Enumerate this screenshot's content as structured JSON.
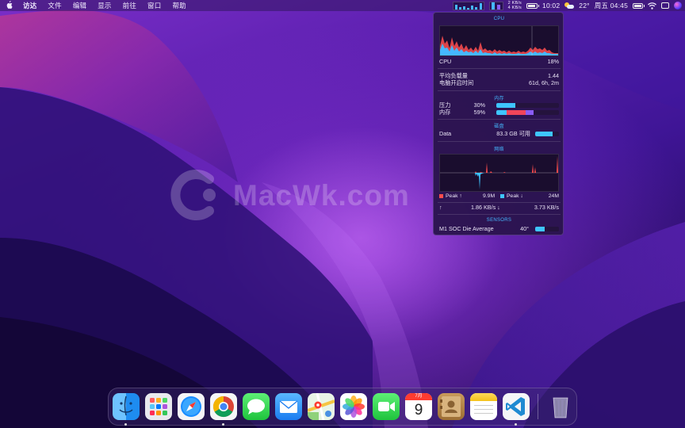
{
  "menubar": {
    "items": [
      "访达",
      "文件",
      "编辑",
      "显示",
      "前往",
      "窗口",
      "帮助"
    ],
    "status": {
      "net_up": "2 KB/s",
      "net_down": "4 KB/s",
      "time_short": "10:02",
      "temperature": "22°",
      "datetime": "周五 04:45"
    },
    "icons": [
      "apple-icon",
      "stats-graph-icon",
      "battery-icon",
      "weather-icon",
      "wifi-icon",
      "control-center-icon",
      "siri-icon"
    ]
  },
  "popup": {
    "cpu": {
      "title": "CPU",
      "label": "CPU",
      "usage": "18%",
      "load_label": "平均负载量",
      "load_value": "1.44",
      "uptime_label": "电脑开启时间",
      "uptime_value": "61d, 6h, 2m"
    },
    "memory": {
      "title": "内存",
      "pressure_label": "压力",
      "pressure_value": "30%",
      "pressure_fraction": 0.3,
      "mem_label": "内存",
      "mem_value": "59%",
      "mem_fraction": 0.59
    },
    "disk": {
      "title": "磁盘",
      "name": "Data",
      "free": "83.3 GB 可用",
      "used_fraction": 0.72
    },
    "network": {
      "title": "网络",
      "peak_up_label": "Peak ↑",
      "peak_up_value": "9.9M",
      "peak_down_label": "Peak ↓",
      "peak_down_value": "24M",
      "up_arrow": "↑",
      "up_rate": "1.86 KB/s ↓",
      "down_rate": "3.73 KB/s"
    },
    "sensors": {
      "title": "SENSORS",
      "name": "M1 SOC Die Average",
      "value": "40°",
      "fraction": 0.4
    }
  },
  "watermark": {
    "text": "MacWk.com"
  },
  "dock": {
    "apps": [
      "Finder",
      "Launchpad",
      "Safari",
      "Chrome",
      "Messages",
      "Mail",
      "Maps",
      "Photos",
      "FaceTime",
      "Calendar",
      "Contacts",
      "Notes",
      "VS Code",
      "Trash"
    ],
    "calendar_month": "7月",
    "calendar_day": "9"
  },
  "colors": {
    "accent": "#45b8ff",
    "cpu_red": "#ff4d4d",
    "mem_red": "#f0455a",
    "mem_purple": "#8a5cf6",
    "popup_bg": "#2b144e"
  }
}
